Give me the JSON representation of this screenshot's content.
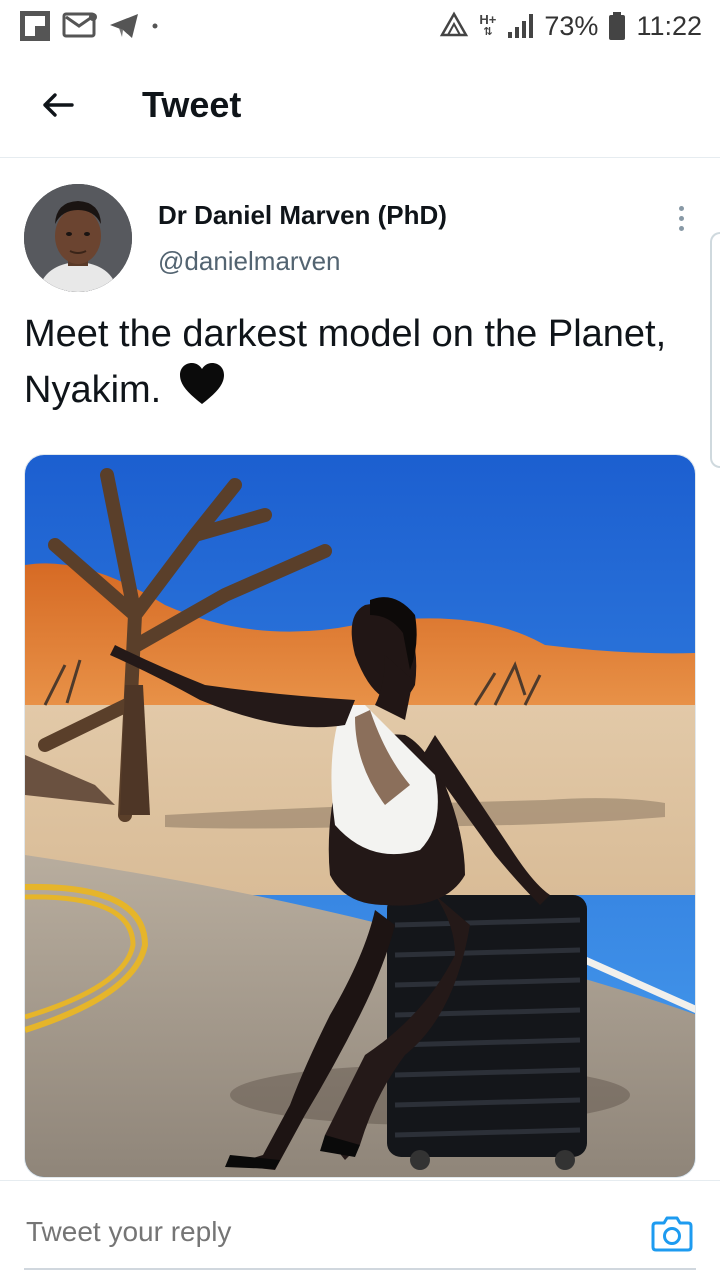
{
  "status_bar": {
    "battery": "73%",
    "time": "11:22",
    "network": "H+"
  },
  "app_bar": {
    "title": "Tweet"
  },
  "tweet": {
    "author_name": "Dr Daniel Marven (PhD)",
    "author_handle": "@danielmarven",
    "text": "Meet the darkest model on the Planet, Nyakim.",
    "emoji": "black-heart-icon"
  },
  "reply": {
    "placeholder": "Tweet your reply"
  },
  "colors": {
    "accent": "#1d9bf0",
    "text_primary": "#0f1419",
    "text_secondary": "#536471"
  }
}
